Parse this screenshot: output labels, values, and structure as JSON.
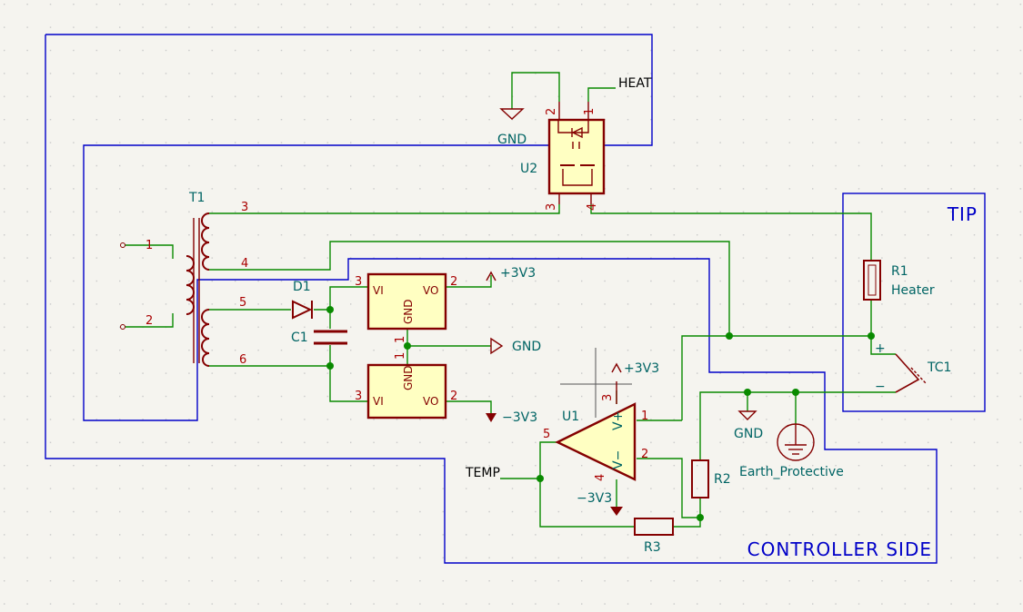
{
  "colors": {
    "wire": "#098a00",
    "sheet_border": "#0000c8",
    "component": "#840000",
    "component_fill": "#ffffc2",
    "reference": "#006464",
    "pin_number": "#a90000",
    "background": "#f5f4ef"
  },
  "areas": {
    "tip": "TIP",
    "controller": "CONTROLLER SIDE"
  },
  "labels": {
    "heat": "HEAT",
    "temp": "TEMP"
  },
  "components": {
    "t1": {
      "ref": "T1",
      "pins": [
        "1",
        "2",
        "3",
        "4",
        "5",
        "6"
      ]
    },
    "d1": {
      "ref": "D1"
    },
    "c1": {
      "ref": "C1"
    },
    "reg_top": {
      "vi": "VI",
      "vo": "VO",
      "gnd": "GND",
      "pin_vi": "3",
      "pin_vo": "2",
      "pin_gnd": "1"
    },
    "reg_bot": {
      "vi": "VI",
      "vo": "VO",
      "gnd": "GND",
      "pin_vi": "3",
      "pin_vo": "2",
      "pin_gnd": "1"
    },
    "u2": {
      "ref": "U2",
      "pins": [
        "2",
        "1",
        "3",
        "4"
      ]
    },
    "u1": {
      "ref": "U1",
      "pins": [
        "5",
        "1",
        "2",
        "3",
        "4"
      ],
      "vplus": "V+",
      "vminus": "V−"
    },
    "r1": {
      "ref": "R1",
      "value": "Heater"
    },
    "r2": {
      "ref": "R2"
    },
    "r3": {
      "ref": "R3"
    },
    "tc1": {
      "ref": "TC1",
      "plus": "+",
      "minus": "−"
    }
  },
  "power": {
    "gnd_u2": "GND",
    "p3v3_reg": "+3V3",
    "gnd_reg": "GND",
    "m3v3_reg": "−3V3",
    "p3v3_u1": "+3V3",
    "m3v3_u1": "−3V3",
    "gnd_tip": "GND",
    "earth": "Earth_Protective"
  }
}
